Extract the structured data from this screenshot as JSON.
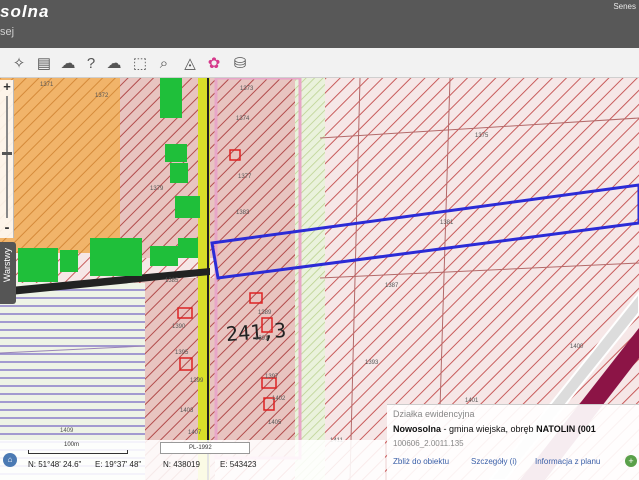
{
  "header": {
    "brand": "solna",
    "subtitle": "sej",
    "user_link": "Senes"
  },
  "toolbar": {
    "tools": [
      {
        "name": "navigation-icon",
        "glyph": "✧"
      },
      {
        "name": "layout-icon",
        "glyph": "▤"
      },
      {
        "name": "comment-icon",
        "glyph": "☁"
      },
      {
        "name": "help-icon",
        "glyph": "?"
      },
      {
        "name": "cloud-upload-icon",
        "glyph": "☁"
      },
      {
        "name": "search-zoom-icon",
        "glyph": "⌕"
      },
      {
        "name": "measure-icon",
        "glyph": "◬"
      },
      {
        "name": "color-palette-icon",
        "glyph": "✿"
      },
      {
        "name": "layers-stack-icon",
        "glyph": "⛁"
      }
    ]
  },
  "sidebar": {
    "zoom_in": "+",
    "zoom_out": "-",
    "layers_tab": "Warstwy"
  },
  "map": {
    "handwritten_label": "241,3",
    "parcel_labels": [
      "1371",
      "1372",
      "1373",
      "1374",
      "1375",
      "1377",
      "1379",
      "1381",
      "1383",
      "1385",
      "1387",
      "1389",
      "1390",
      "1391",
      "1393",
      "1395",
      "1397",
      "1399",
      "1400",
      "1401",
      "1402",
      "1403",
      "1405",
      "1407",
      "1409",
      "1411"
    ]
  },
  "status": {
    "scale_label": "100m",
    "projection": "PL-1992",
    "lat": "N: 51°48' 24.6\"",
    "lon": "E: 19°37' 48\"",
    "north": "N: 438019",
    "east": "E: 543423",
    "home_icon": "home-icon"
  },
  "info_panel": {
    "title": "Działka ewidencyjna",
    "name_prefix": "Nowosolna",
    "name_middle": " - gmina wiejska",
    "name_sep": ", obręb ",
    "name_suffix": "NATOLIN (001",
    "parcel_id": "100606_2.0011.135",
    "link_zoom": "Zbliż do obiektu",
    "link_details": "Szczegóły (i)",
    "link_info": "Informacja z planu"
  },
  "colors": {
    "hatch": "#c85c5c",
    "road_yellow": "#d8df2a",
    "green_building": "#1fbf3a",
    "orange_zone": "#f1b46a",
    "selection_blue": "#2b2bd6",
    "magenta_rail": "#8c1446"
  }
}
